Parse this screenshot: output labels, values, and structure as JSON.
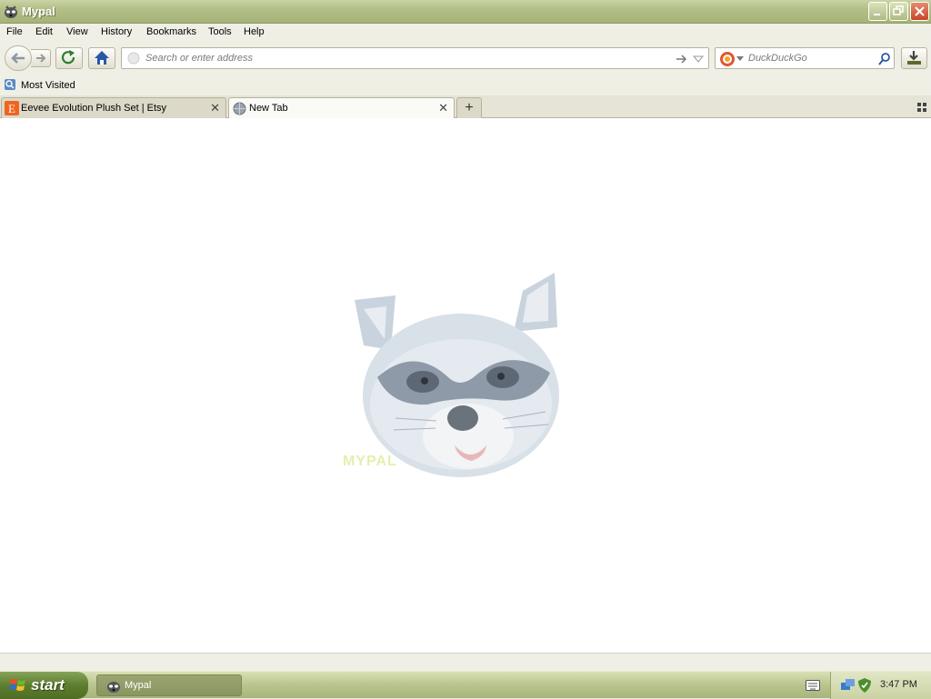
{
  "window": {
    "title": "Mypal"
  },
  "menu": {
    "items": [
      "File",
      "Edit",
      "View",
      "History",
      "Bookmarks",
      "Tools",
      "Help"
    ]
  },
  "urlbar": {
    "placeholder": "Search or enter address"
  },
  "search": {
    "placeholder": "DuckDuckGo"
  },
  "bookmarks": {
    "items": [
      {
        "label": "Most Visited"
      }
    ]
  },
  "tabs": [
    {
      "label": "Eevee Evolution Plush Set | Etsy",
      "icon": "etsy-icon"
    },
    {
      "label": "New Tab",
      "icon": "globe-icon"
    }
  ],
  "newtab": {
    "logo": "MYPAL",
    "logo_icon": "raccoon-logo"
  },
  "taskbar": {
    "start_label": "start",
    "task": "Mypal",
    "clock": "3:47 PM"
  },
  "colors": {
    "etsy": "#F1641E",
    "title_text": "#FFFFFF",
    "start_green": "#5C7E2E"
  }
}
